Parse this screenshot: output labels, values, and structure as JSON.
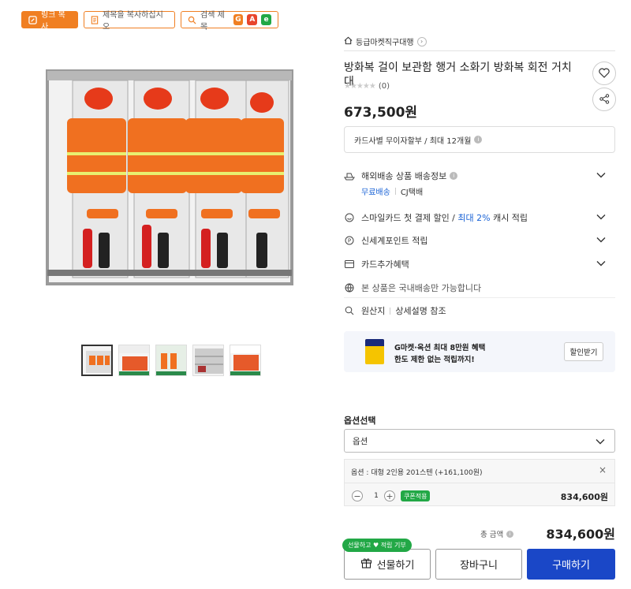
{
  "topbar": {
    "link_copy": "링크 복사",
    "title_copy": "제목을 복사하십시오",
    "search_title": "검색 제목"
  },
  "seller": {
    "name": "등급마켓직구대행"
  },
  "product": {
    "title": "방화복 걸이 보관함 행거 소화기 방화복 회전 거치대",
    "review_count": "(0)",
    "price": "673,500원"
  },
  "card_info": "카드사별 무이자할부 / 최대 12개월",
  "shipping": {
    "label": "해외배송 상품 배송정보",
    "free": "무료배송",
    "carrier": "CJ택배"
  },
  "smile": {
    "text_a": "스마일카드 첫 결제 할인 / ",
    "highlight": "최대 2%",
    "text_b": " 캐시 적립"
  },
  "points": "신세계포인트 적립",
  "card_extra": "카드추가혜택",
  "domestic": "본 상품은 국내배송만 가능합니다",
  "origin": {
    "label": "원산지",
    "value": "상세설명 참조"
  },
  "promo": {
    "line1": "G마켓·옥션 최대 8만원 혜택",
    "line2": "한도 제한 없는 적립까지!",
    "button": "할인받기"
  },
  "options": {
    "heading": "옵션선택",
    "select_value": "옵션",
    "selected_item": "옵션 : 대형 2인용 201스텐 (+161,100원)",
    "qty": "1",
    "coupon_label": "쿠폰적용",
    "item_price": "834,600원"
  },
  "total": {
    "label": "총 금액",
    "value": "834,600원"
  },
  "actions": {
    "gift_badge": "선물하고 ♥ 적립 기부",
    "gift": "선물하기",
    "cart": "장바구니",
    "buy": "구매하기"
  },
  "colors": {
    "accent": "#f07f22",
    "buy": "#1a47c7",
    "green": "#22a846",
    "link": "#1a63d6"
  }
}
